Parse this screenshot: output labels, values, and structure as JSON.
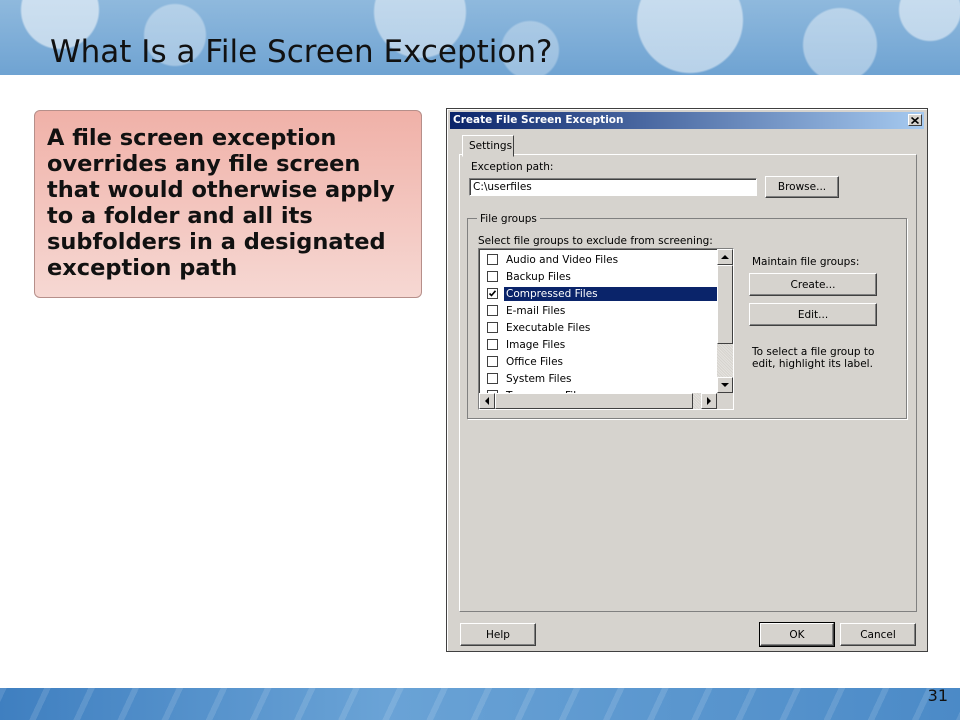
{
  "slide": {
    "title": "What Is a File Screen Exception?",
    "callout": "A file screen exception overrides any file screen that would otherwise apply to a folder and all its subfolders in a designated exception path",
    "page_number": "31"
  },
  "dialog": {
    "title": "Create File Screen Exception",
    "close_icon": "close-icon",
    "tab_label": "Settings",
    "exception_path_label": "Exception path:",
    "exception_path_value": "C:\\userfiles",
    "browse_label": "Browse...",
    "file_groups_legend": "File groups",
    "select_groups_label": "Select file groups to exclude from screening:",
    "file_groups": [
      {
        "label": "Audio and Video Files",
        "checked": false,
        "selected": false
      },
      {
        "label": "Backup Files",
        "checked": false,
        "selected": false
      },
      {
        "label": "Compressed Files",
        "checked": true,
        "selected": true
      },
      {
        "label": "E-mail Files",
        "checked": false,
        "selected": false
      },
      {
        "label": "Executable Files",
        "checked": false,
        "selected": false
      },
      {
        "label": "Image Files",
        "checked": false,
        "selected": false
      },
      {
        "label": "Office Files",
        "checked": false,
        "selected": false
      },
      {
        "label": "System Files",
        "checked": false,
        "selected": false
      },
      {
        "label": "Temporary Files",
        "checked": false,
        "selected": false
      }
    ],
    "maintain_label": "Maintain file groups:",
    "create_label": "Create...",
    "edit_label": "Edit...",
    "hint_text": "To select a file group to edit, highlight its label.",
    "help_label": "Help",
    "ok_label": "OK",
    "cancel_label": "Cancel"
  },
  "colors": {
    "titlebar": "#0a246a",
    "selection": "#0a246a",
    "dialog_face": "#d6d3ce"
  }
}
